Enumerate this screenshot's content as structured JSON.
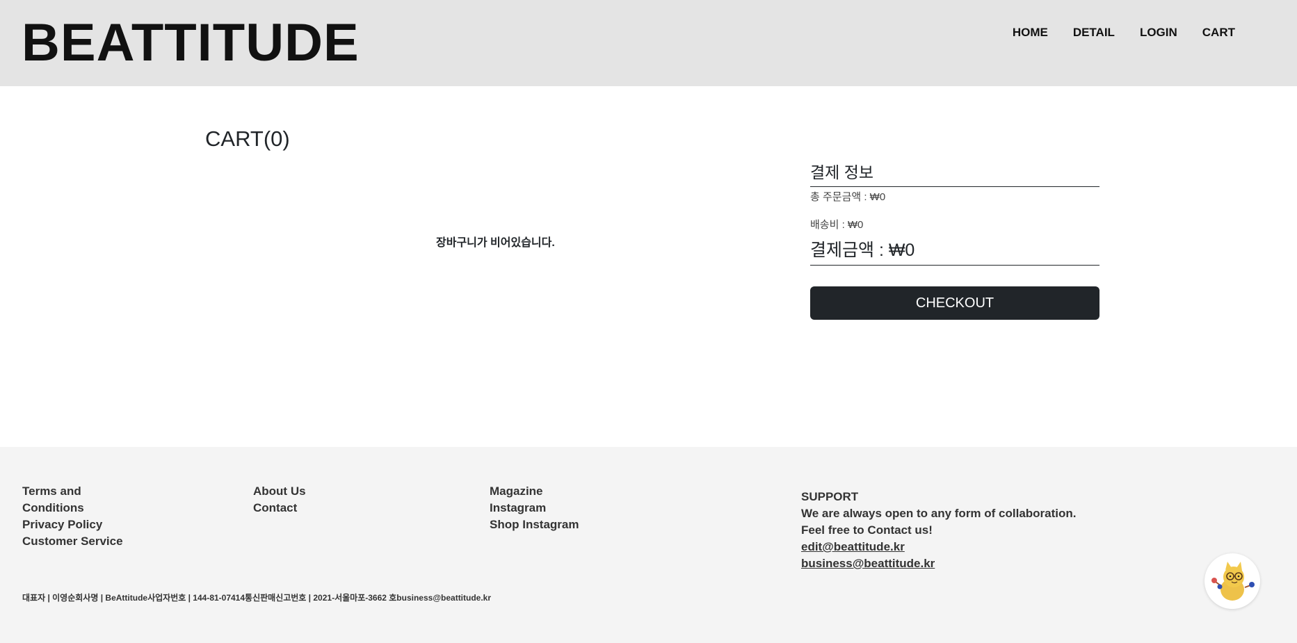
{
  "header": {
    "logo": "BEATTITUDE",
    "nav": [
      "HOME",
      "DETAIL",
      "LOGIN",
      "CART"
    ]
  },
  "cart": {
    "title": "CART(0)",
    "empty_message": "장바구니가 비어있습니다."
  },
  "payment": {
    "title": "결제 정보",
    "order_total": "총 주문금액 : ₩0",
    "shipping": "배송비 : ₩0",
    "total": "결제금액 : ₩0",
    "checkout_label": "CHECKOUT"
  },
  "footer": {
    "col1": [
      "Terms and Conditions",
      "Privacy Policy",
      "Customer Service"
    ],
    "col2": [
      "About Us",
      "Contact"
    ],
    "col3": [
      "Magazine",
      "Instagram",
      "Shop Instagram"
    ],
    "support": {
      "heading": "SUPPORT",
      "line1": "We are always open to any form of collaboration.",
      "line2": "Feel free to Contact us!",
      "email1": "edit@beattitude.kr",
      "email2": "business@beattitude.kr"
    },
    "company_info": "대표자 | 이영순회사명 | BeAttitude사업자번호 | 144-81-07414통신판매신고번호 | 2021-서울마포-3662 호business@beattitude.kr"
  },
  "colors": {
    "header_bg": "#e4e4e4",
    "footer_bg": "#f4f4f4",
    "button_bg": "#212529",
    "mascot_yellow": "#f2c94c"
  },
  "icons": {
    "chat_widget": "cat-mascot-icon"
  }
}
